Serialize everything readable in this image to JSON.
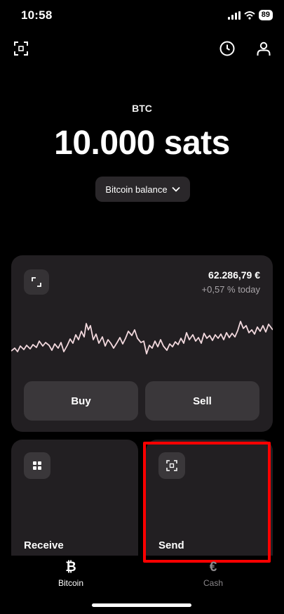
{
  "status_bar": {
    "time": "10:58",
    "battery": "89"
  },
  "header": {
    "icons": [
      "scan-icon",
      "history-icon",
      "profile-icon"
    ]
  },
  "balance": {
    "currency_code": "BTC",
    "amount": "10.000 sats",
    "selector_label": "Bitcoin balance"
  },
  "chart_card": {
    "price": "62.286,79 €",
    "change": "+0,57 % today",
    "buy_label": "Buy",
    "sell_label": "Sell",
    "line_color": "#f3d9de"
  },
  "actions": {
    "receive_label": "Receive",
    "send_label": "Send"
  },
  "tabs": [
    {
      "icon": "₿",
      "label": "Bitcoin",
      "active": true
    },
    {
      "icon": "€",
      "label": "Cash",
      "active": false
    }
  ],
  "colors": {
    "background": "#000000",
    "card": "#221f22",
    "button": "#3a373a",
    "highlight": "#ff0000",
    "inactive_tab": "#8a878a"
  }
}
